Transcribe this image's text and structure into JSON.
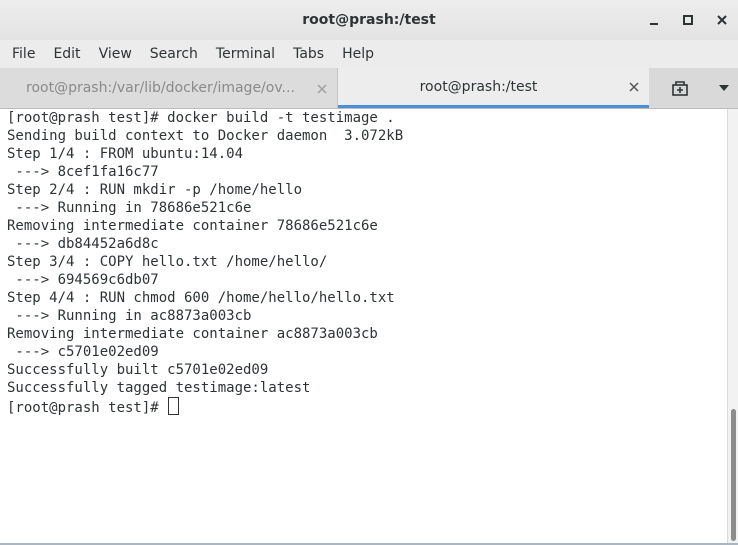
{
  "window": {
    "title": "root@prash:/test"
  },
  "menu": [
    "File",
    "Edit",
    "View",
    "Search",
    "Terminal",
    "Tabs",
    "Help"
  ],
  "tabs": [
    {
      "label": "root@prash:/var/lib/docker/image/ov...",
      "active": false
    },
    {
      "label": "root@prash:/test",
      "active": true
    }
  ],
  "terminal": {
    "lines": [
      "[root@prash test]# docker build -t testimage .",
      "Sending build context to Docker daemon  3.072kB",
      "Step 1/4 : FROM ubuntu:14.04",
      " ---> 8cef1fa16c77",
      "Step 2/4 : RUN mkdir -p /home/hello",
      " ---> Running in 78686e521c6e",
      "Removing intermediate container 78686e521c6e",
      " ---> db84452a6d8c",
      "Step 3/4 : COPY hello.txt /home/hello/",
      " ---> 694569c6db07",
      "Step 4/4 : RUN chmod 600 /home/hello/hello.txt",
      " ---> Running in ac8873a003cb",
      "Removing intermediate container ac8873a003cb",
      " ---> c5701e02ed09",
      "Successfully built c5701e02ed09",
      "Successfully tagged testimage:latest"
    ],
    "prompt": "[root@prash test]# "
  },
  "icons": {
    "minimize": "minimize-icon",
    "maximize": "maximize-icon",
    "close": "close-icon",
    "new_tab": "new-tab-icon",
    "tab_menu": "chevron-down-icon"
  },
  "colors": {
    "accent": "#4a90d9",
    "text": "#2e3436"
  }
}
